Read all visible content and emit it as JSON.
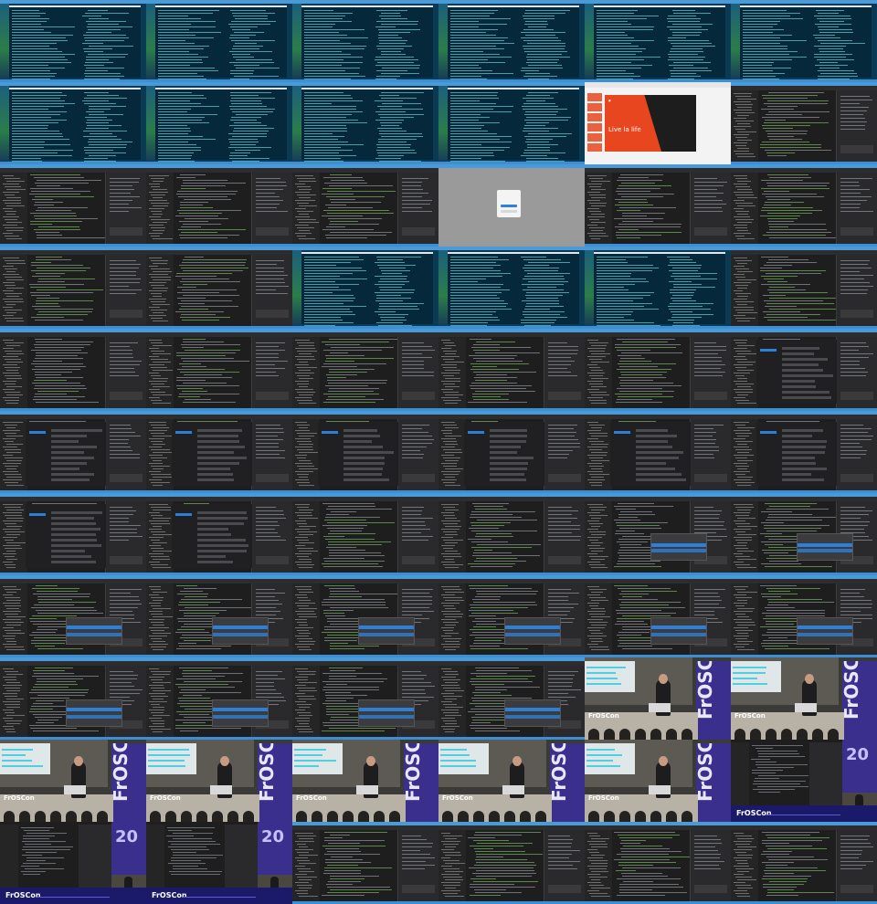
{
  "page": {
    "columns": 6,
    "rows": 11
  },
  "labels": {
    "live_la_life": "Live la life",
    "froscon": "FrOSCon",
    "froscon_vertical": "FrOSCon",
    "number_20": "20"
  },
  "frames": [
    "term",
    "term",
    "term",
    "term",
    "term",
    "term",
    "term",
    "term",
    "term",
    "term",
    "browser",
    "editor",
    "editor",
    "editor",
    "editor",
    "grey",
    "editor",
    "editor",
    "editor",
    "editor",
    "term",
    "term",
    "term",
    "editor",
    "editor",
    "editor",
    "editor",
    "editor",
    "editor",
    "settings",
    "settings",
    "settings",
    "settings",
    "settings",
    "settings",
    "settings",
    "settings",
    "settings",
    "editor",
    "editor",
    "popup-top",
    "popup-top",
    "popup-mid",
    "popup-mid",
    "popup-mid",
    "popup-mid",
    "popup-mid",
    "popup-mid",
    "popup-mid",
    "popup-mid",
    "popup-mid",
    "popup-mid",
    "camera",
    "camera",
    "camera",
    "camera",
    "camera",
    "camera",
    "camera",
    "composite-cam",
    "composite",
    "composite",
    "editor",
    "editor",
    "editor",
    "editor"
  ],
  "colors": {
    "terminal_bg": "#05283b",
    "editor_bg": "#1e1e1e",
    "accent_blue": "#2d7fd8",
    "slide_red": "#e8461f",
    "banner_purple": "#3a2f8c"
  }
}
